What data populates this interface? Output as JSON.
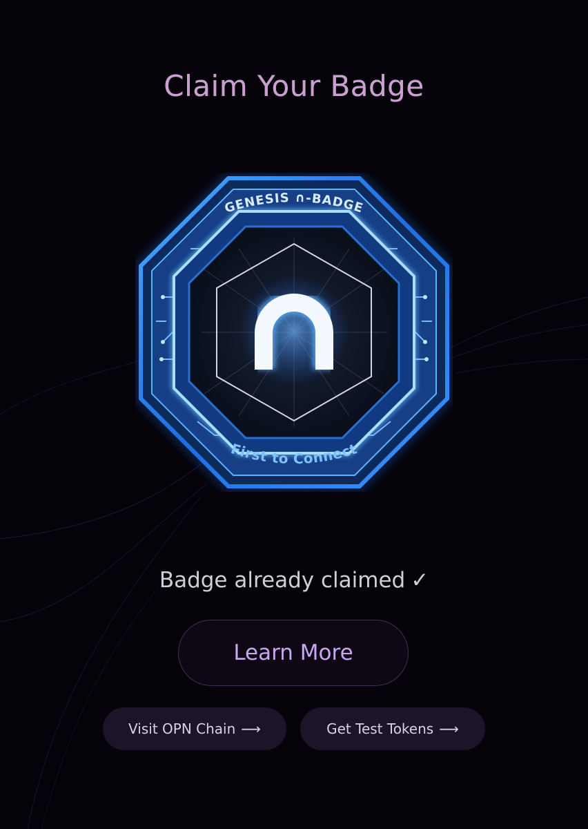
{
  "header": {
    "title": "Claim Your Badge"
  },
  "badge": {
    "top_text": "GENESIS ∩-BADGE",
    "bottom_text": "First to Connect",
    "center_glyph": "n",
    "primary_color": "#3b8cff",
    "glow_color": "#1a5fd6",
    "icon": "badge-octagon-icon"
  },
  "status": {
    "text": "Badge already claimed",
    "check": "✓"
  },
  "actions": {
    "learn_more": "Learn More",
    "visit_opn": "Visit OPN Chain",
    "test_tokens": "Get Test Tokens",
    "arrow": "⟶"
  },
  "colors": {
    "background": "#050309",
    "title": "#c9a0d0",
    "accent": "#c9a6f0",
    "pill_bg": "#1c1428"
  }
}
